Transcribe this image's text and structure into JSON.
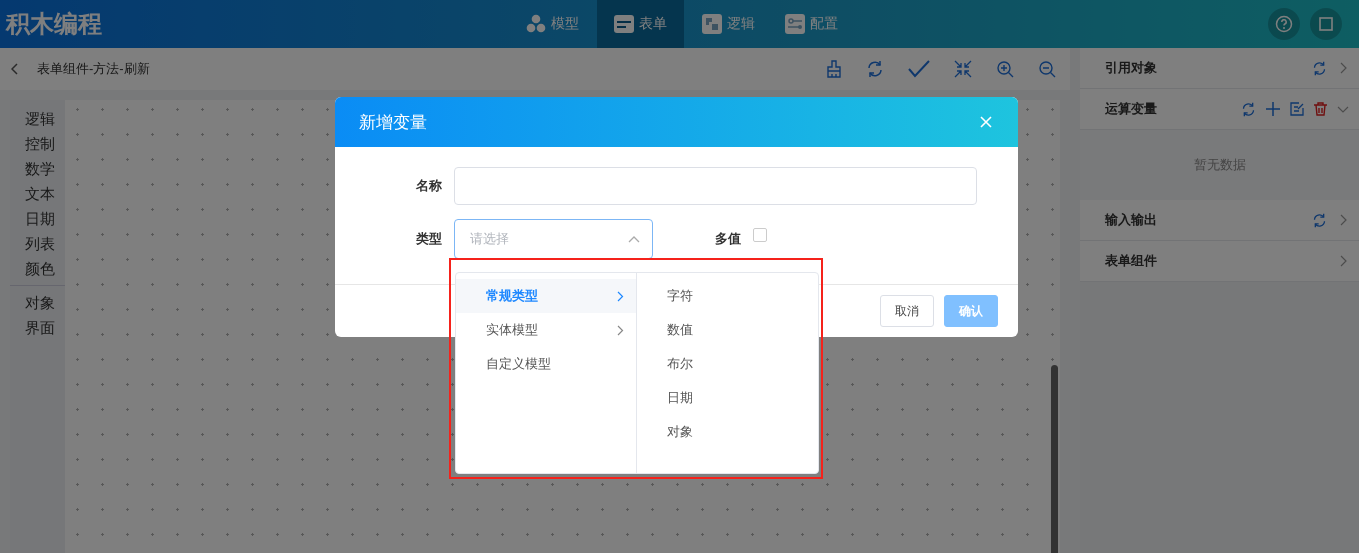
{
  "app": {
    "title": "积木编程"
  },
  "nav_tabs": [
    {
      "label": "模型",
      "selected": false
    },
    {
      "label": "表单",
      "selected": true
    },
    {
      "label": "逻辑",
      "selected": false
    },
    {
      "label": "配置",
      "selected": false
    }
  ],
  "breadcrumb": "表单组件-方法-刷新",
  "palette": {
    "groups": [
      {
        "items": [
          "逻辑",
          "控制",
          "数学",
          "文本",
          "日期",
          "列表",
          "颜色"
        ]
      },
      {
        "items": [
          "对象",
          "界面"
        ]
      }
    ]
  },
  "right_panel": {
    "sections": [
      {
        "title": "引用对象",
        "expanded": false,
        "kind": "refreshable"
      },
      {
        "title": "运算变量",
        "expanded": true,
        "kind": "editable",
        "empty_text": "暂无数据"
      },
      {
        "title": "输入输出",
        "expanded": false,
        "kind": "refreshable"
      },
      {
        "title": "表单组件",
        "expanded": false,
        "kind": "plain"
      }
    ]
  },
  "dialog": {
    "title": "新增变量",
    "name_field": {
      "label": "名称"
    },
    "type_field": {
      "label": "类型",
      "placeholder": "请选择",
      "expanded": true
    },
    "multi_value": {
      "label": "多值",
      "checked": false
    },
    "buttons": [
      {
        "label": "取消",
        "kind": "secondary",
        "disabled": false
      },
      {
        "label": "确认",
        "kind": "primary",
        "disabled": true
      }
    ]
  },
  "cascader": {
    "highlighted": true,
    "columns": [
      {
        "options": [
          {
            "label": "常规类型",
            "selected": true,
            "has_children": true
          },
          {
            "label": "实体模型",
            "selected": false,
            "has_children": true
          },
          {
            "label": "自定义模型",
            "selected": false,
            "has_children": false
          }
        ]
      },
      {
        "options": [
          {
            "label": "字符",
            "selected": false,
            "has_children": false
          },
          {
            "label": "数值",
            "selected": false,
            "has_children": false
          },
          {
            "label": "布尔",
            "selected": false,
            "has_children": false
          },
          {
            "label": "日期",
            "selected": false,
            "has_children": false
          },
          {
            "label": "对象",
            "selected": false,
            "has_children": false
          }
        ]
      }
    ]
  }
}
